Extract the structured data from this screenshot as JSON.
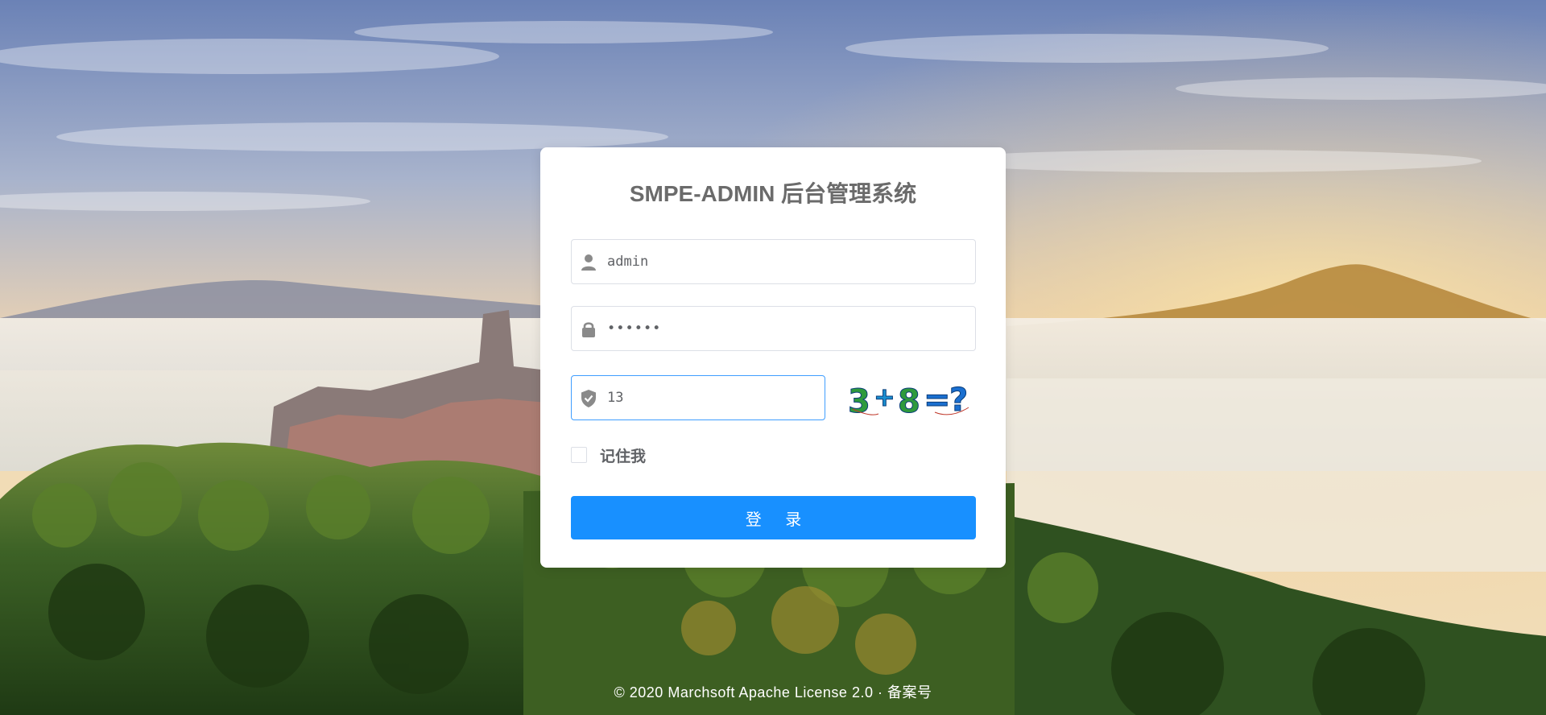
{
  "app": {
    "title": "SMPE-ADMIN 后台管理系统"
  },
  "login": {
    "username_value": "admin",
    "password_value": "123456",
    "code_value": "13",
    "captcha": {
      "text": "3+8=?",
      "parts": [
        "3",
        "+",
        "8",
        "=",
        "?"
      ],
      "colors": [
        "#2e9a3c",
        "#1a8fd0",
        "#2e9a3c",
        "#1a6fd0",
        "#1a6fd0"
      ]
    },
    "remember_label": "记住我",
    "remember_checked": false,
    "submit_label": "登 录"
  },
  "footer": {
    "text": "© 2020 Marchsoft Apache License 2.0 · 备案号"
  },
  "colors": {
    "primary": "#1890ff",
    "focus_border": "#409eff",
    "card_bg": "#ffffff"
  },
  "icons": {
    "username": "user-icon",
    "password": "lock-icon",
    "code": "shield-icon"
  }
}
